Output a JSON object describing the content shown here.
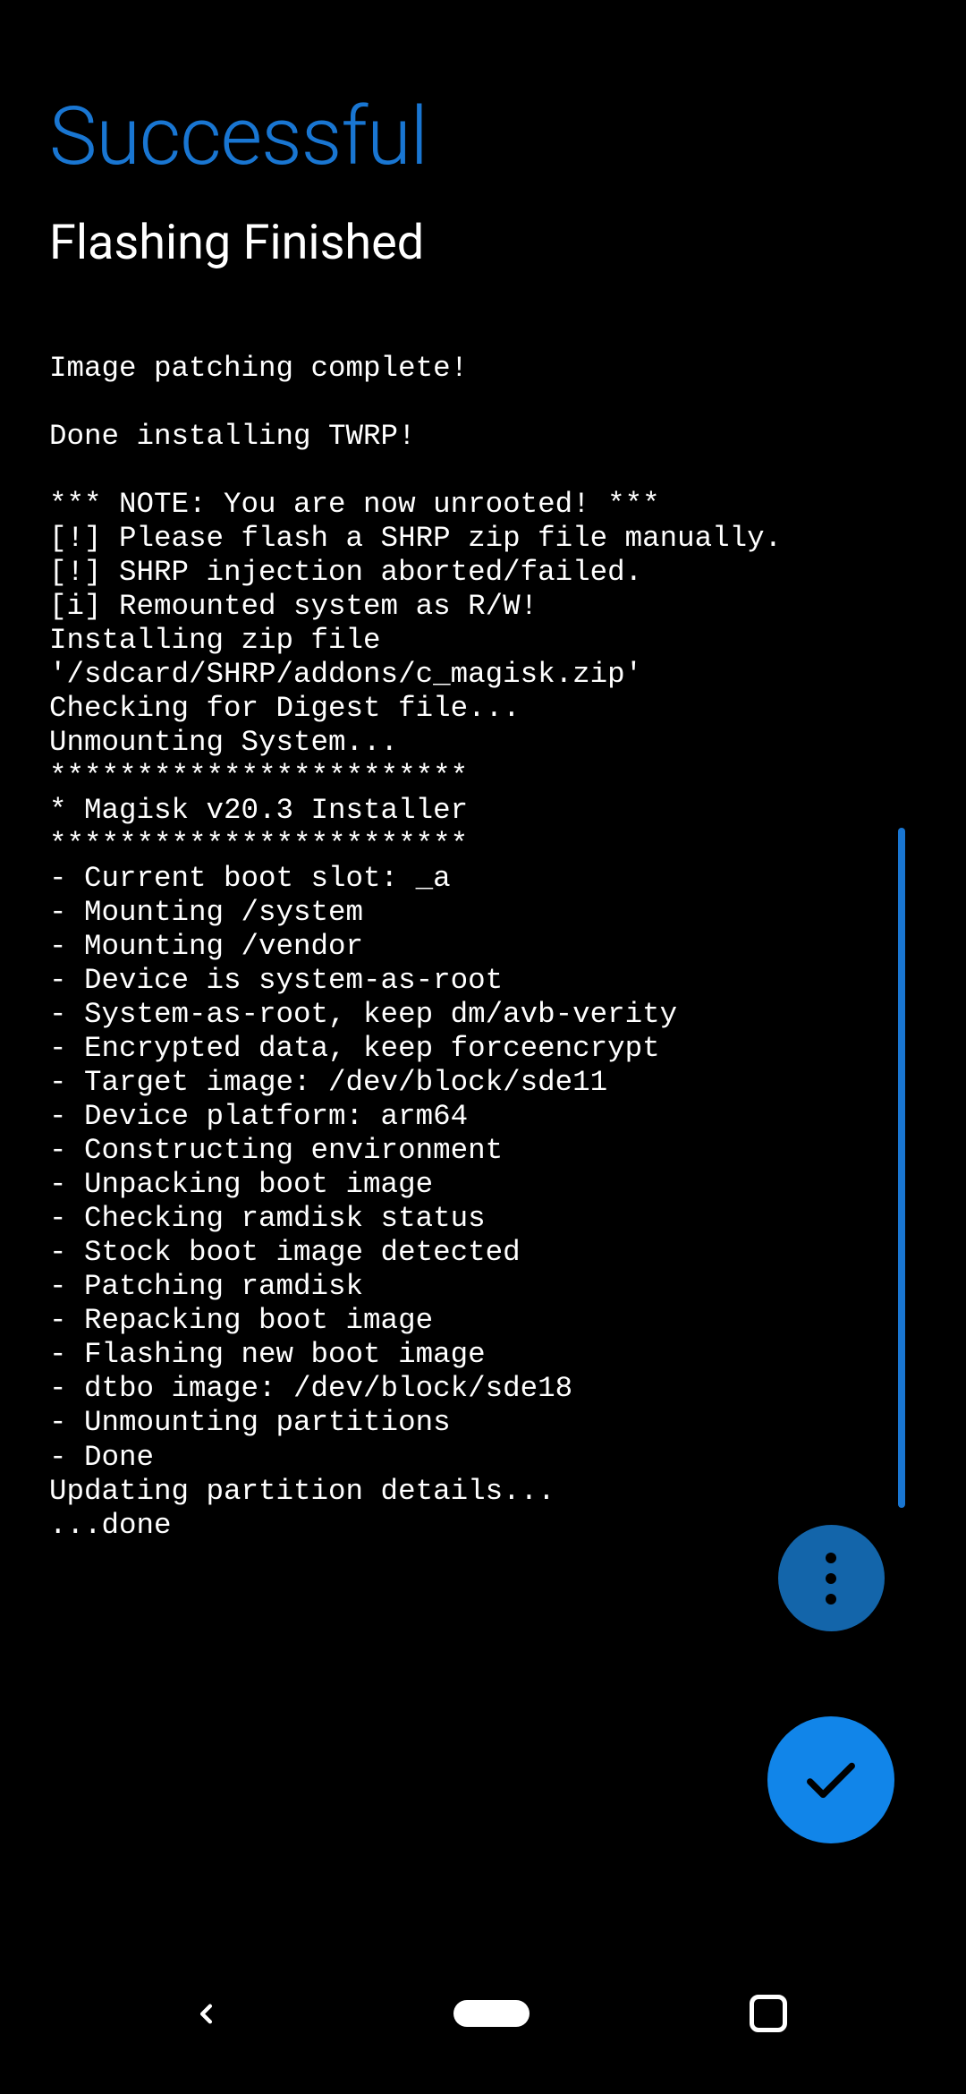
{
  "header": {
    "title": "Successful",
    "subtitle": "Flashing Finished"
  },
  "log": {
    "lines": [
      "Image patching complete!",
      "",
      "Done installing TWRP!",
      "",
      "*** NOTE: You are now unrooted! ***",
      "[!] Please flash a SHRP zip file manually.",
      "[!] SHRP injection aborted/failed.",
      "[i] Remounted system as R/W!",
      "Installing zip file '/sdcard/SHRP/addons/c_magisk.zip'",
      "Checking for Digest file...",
      "Unmounting System...",
      "************************",
      "* Magisk v20.3 Installer",
      "************************",
      "- Current boot slot: _a",
      "- Mounting /system",
      "- Mounting /vendor",
      "- Device is system-as-root",
      "- System-as-root, keep dm/avb-verity",
      "- Encrypted data, keep forceencrypt",
      "- Target image: /dev/block/sde11",
      "- Device platform: arm64",
      "- Constructing environment",
      "- Unpacking boot image",
      "- Checking ramdisk status",
      "- Stock boot image detected",
      "- Patching ramdisk",
      "- Repacking boot image",
      "- Flashing new boot image",
      "- dtbo image: /dev/block/sde18",
      "- Unmounting partitions",
      "- Done",
      "Updating partition details...",
      "...done"
    ]
  },
  "colors": {
    "accent": "#1976d2",
    "fabPrimary": "#1185e9",
    "fabSecondary": "#1365aa",
    "background": "#000000",
    "text": "#ffffff"
  }
}
